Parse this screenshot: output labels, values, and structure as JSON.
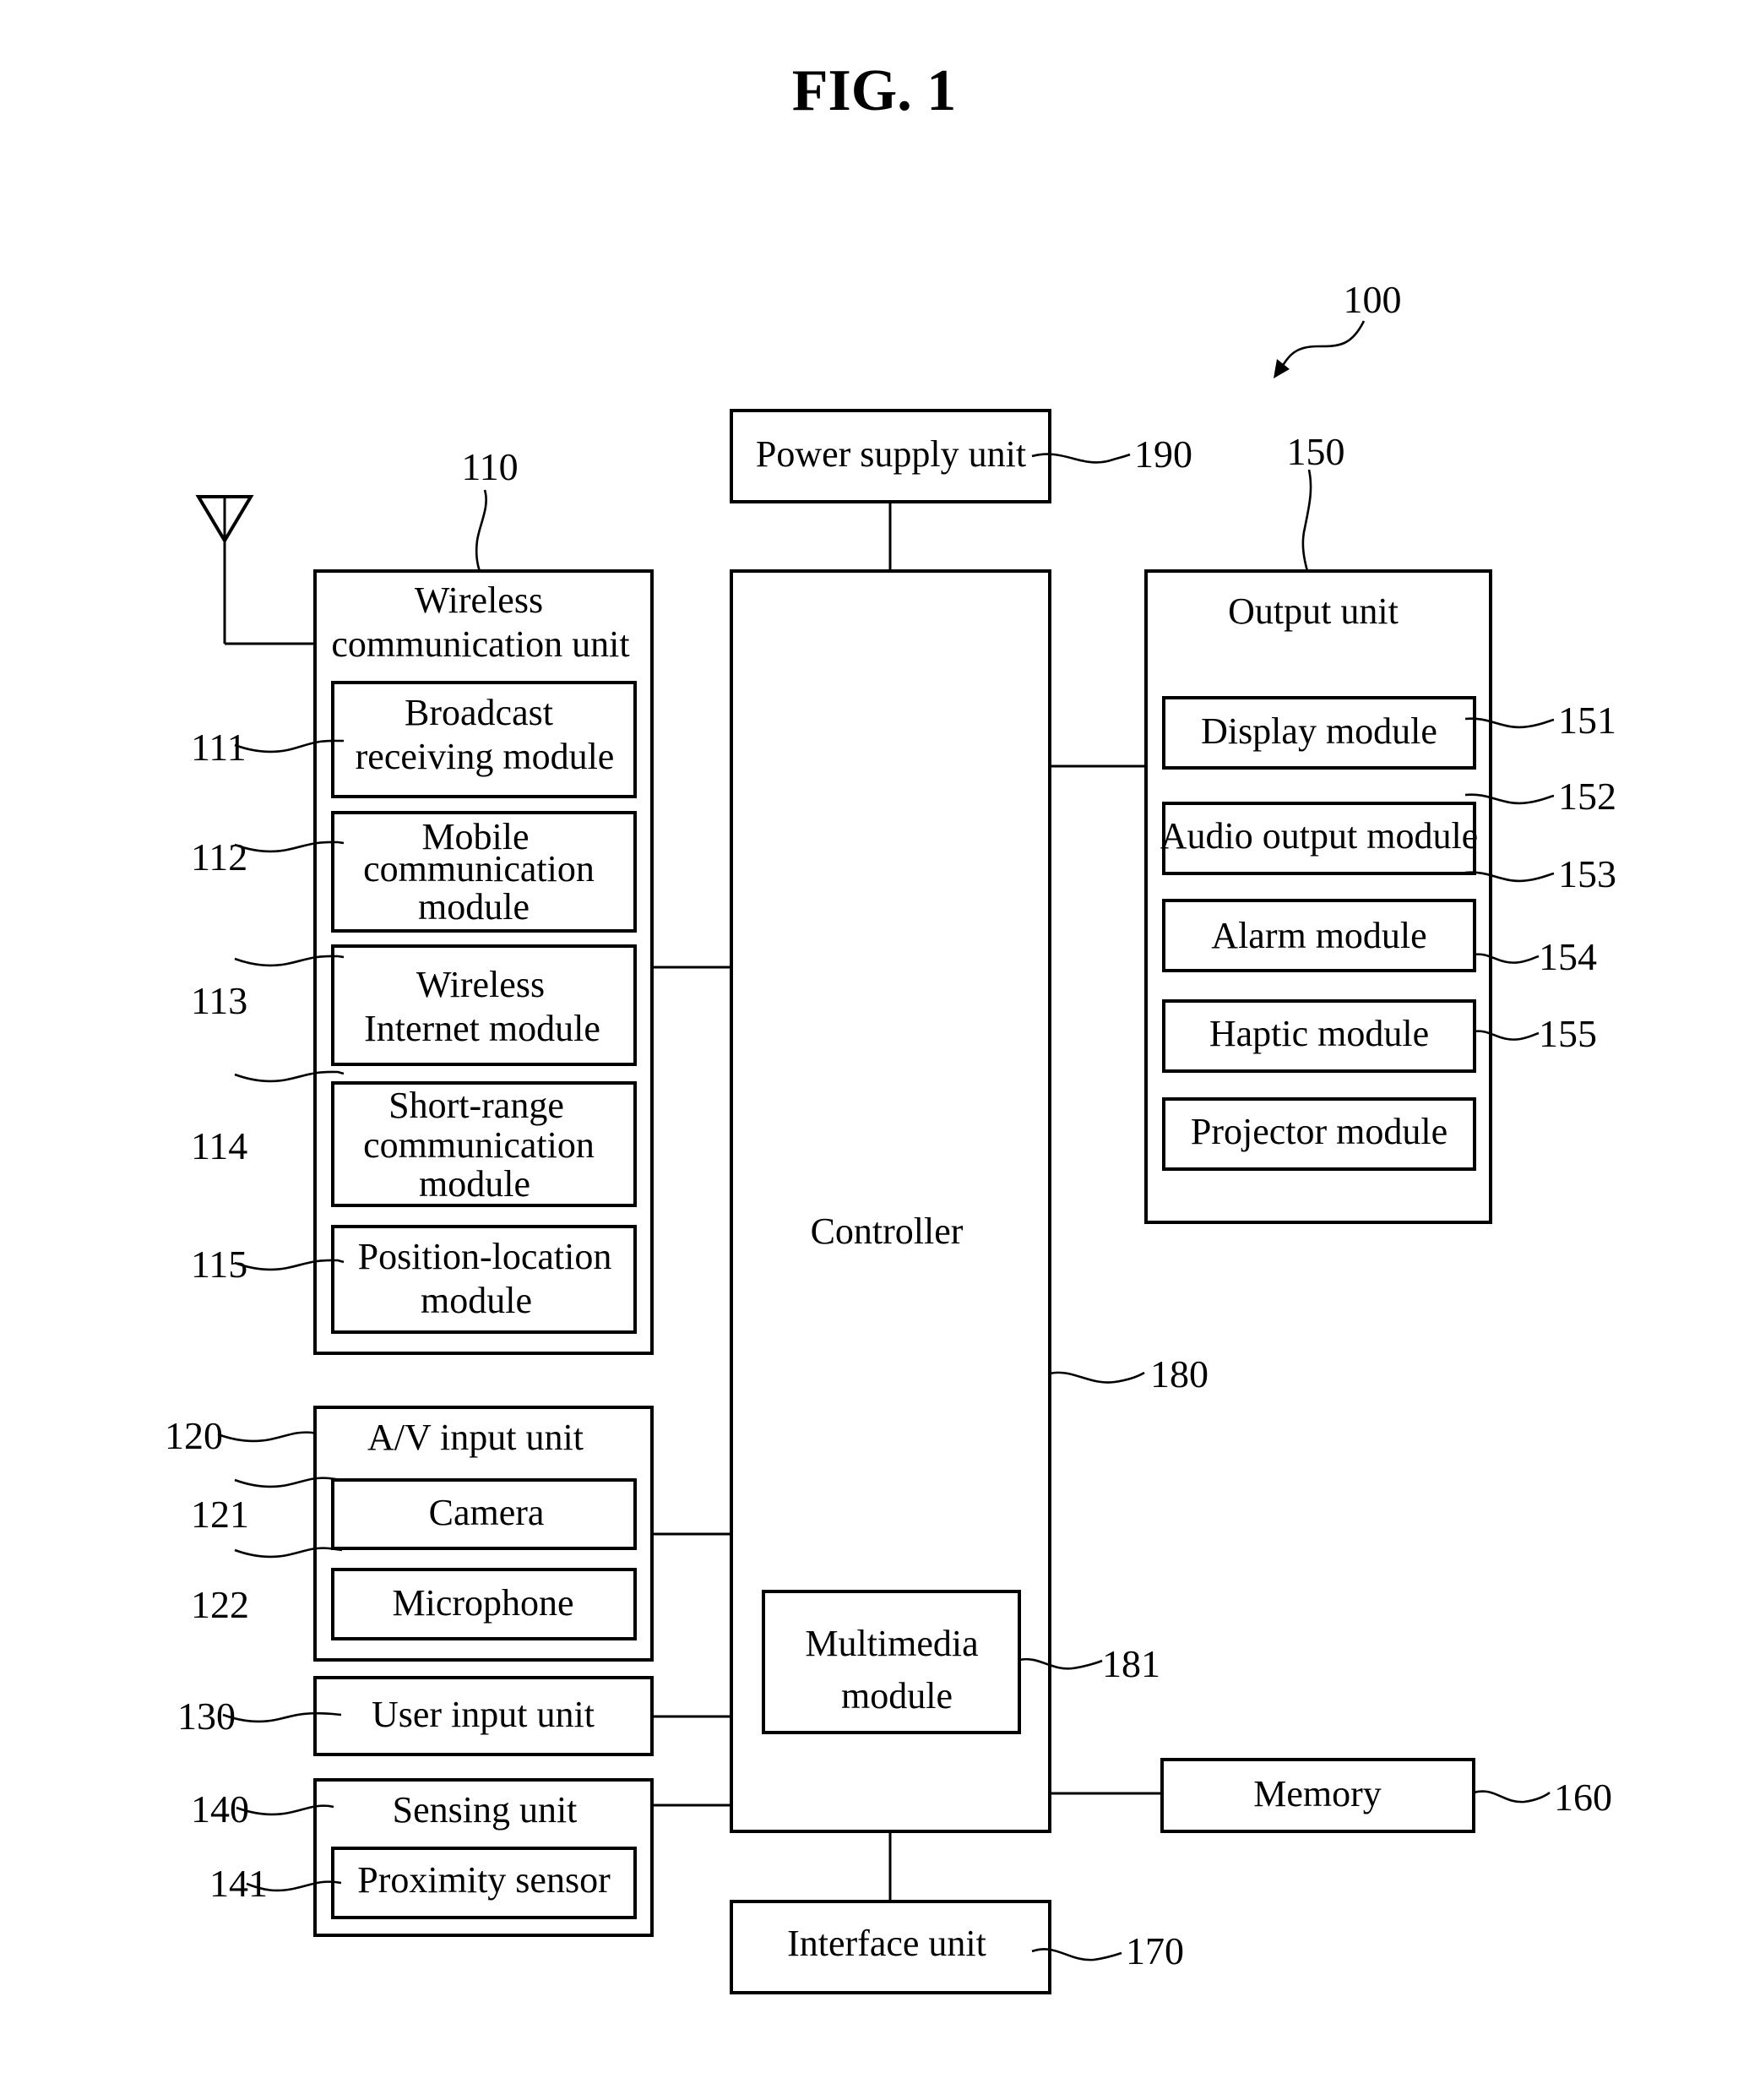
{
  "figure_title": "FIG. 1",
  "device": {
    "ref": "100"
  },
  "power_supply": {
    "label": "Power supply unit",
    "ref": "190"
  },
  "controller": {
    "label": "Controller",
    "ref": "180"
  },
  "multimedia": {
    "label_lines": [
      "Multimedia",
      "module"
    ],
    "ref": "181"
  },
  "interface": {
    "label": "Interface unit",
    "ref": "170"
  },
  "memory": {
    "label": "Memory",
    "ref": "160"
  },
  "wireless": {
    "label_lines": [
      "Wireless",
      "communication unit"
    ],
    "ref": "110",
    "modules": [
      {
        "ref": "111",
        "lines": [
          "Broadcast",
          "receiving module"
        ]
      },
      {
        "ref": "112",
        "lines": [
          "Mobile",
          "communication",
          "module"
        ]
      },
      {
        "ref": "113",
        "lines": [
          "Wireless",
          "Internet module"
        ]
      },
      {
        "ref": "114",
        "lines": [
          "Short-range",
          "communication",
          "module"
        ]
      },
      {
        "ref": "115",
        "lines": [
          "Position-location",
          "module"
        ]
      }
    ]
  },
  "av_input": {
    "label": "A/V input unit",
    "ref": "120",
    "modules": [
      {
        "ref": "121",
        "lines": [
          "Camera"
        ]
      },
      {
        "ref": "122",
        "lines": [
          "Microphone"
        ]
      }
    ]
  },
  "user_input": {
    "label": "User input unit",
    "ref": "130"
  },
  "sensing": {
    "label": "Sensing unit",
    "ref": "140",
    "modules": [
      {
        "ref": "141",
        "lines": [
          "Proximity sensor"
        ]
      }
    ]
  },
  "output": {
    "label": "Output unit",
    "ref": "150",
    "modules": [
      {
        "ref": "151",
        "lines": [
          "Display module"
        ]
      },
      {
        "ref": "152",
        "lines": [
          "Audio output module"
        ]
      },
      {
        "ref": "153",
        "lines": [
          "Alarm module"
        ]
      },
      {
        "ref": "154",
        "lines": [
          "Haptic module"
        ]
      },
      {
        "ref": "155",
        "lines": [
          "Projector module"
        ]
      }
    ]
  }
}
